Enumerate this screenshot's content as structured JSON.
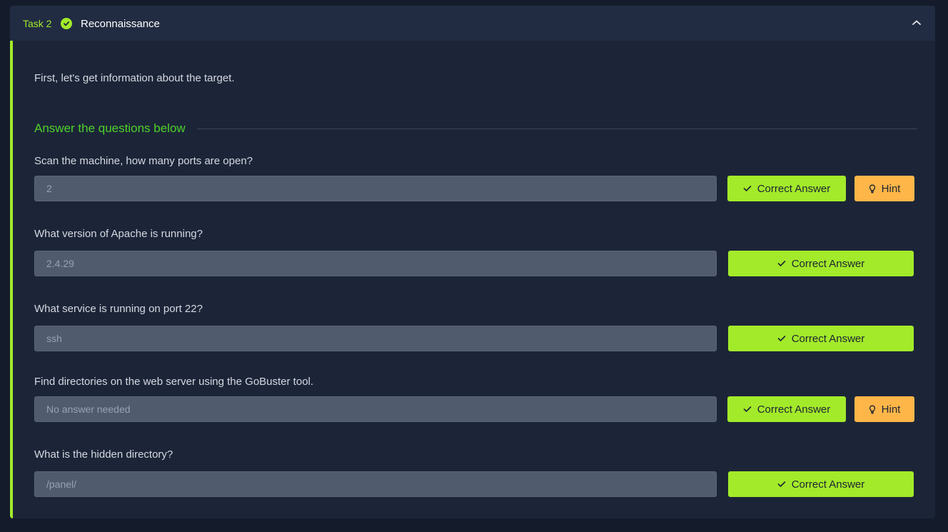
{
  "task": {
    "number_label": "Task 2",
    "title": "Reconnaissance",
    "completed_icon": "check-circle-icon",
    "collapse_icon": "chevron-up-icon"
  },
  "body": {
    "intro": "First, let's get information about the target.",
    "section_title": "Answer the questions below"
  },
  "questions": [
    {
      "label": "Scan the machine, how many ports are open?",
      "answer": "2",
      "submit_label": "Correct Answer",
      "hint_label": "Hint"
    },
    {
      "label": "What version of Apache is running?",
      "answer": "2.4.29",
      "submit_label": "Correct Answer"
    },
    {
      "label": "What service is running on port 22?",
      "answer": "ssh",
      "submit_label": "Correct Answer"
    },
    {
      "label": "Find directories on the web server using the GoBuster tool.",
      "answer": "No answer needed",
      "submit_label": "Correct Answer",
      "hint_label": "Hint"
    },
    {
      "label": "What is the hidden directory?",
      "answer": "/panel/",
      "submit_label": "Correct Answer"
    }
  ],
  "colors": {
    "accent_green": "#a3ea2a",
    "section_green": "#4fd12a",
    "hint_orange": "#ffb648",
    "card_bg": "#1c2538",
    "page_bg": "#141c2b"
  }
}
